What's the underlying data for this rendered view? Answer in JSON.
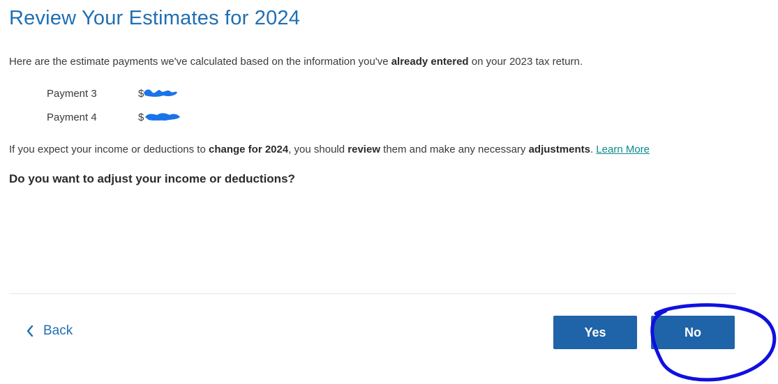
{
  "page_title": "Review Your Estimates for 2024",
  "intro": {
    "part1": "Here are the estimate payments we've calculated based on the information you've ",
    "bold": "already entered",
    "part2": " on your 2023 tax return."
  },
  "payments": [
    {
      "label": "Payment 3",
      "amount_prefix": "$"
    },
    {
      "label": "Payment 4",
      "amount_prefix": "$"
    }
  ],
  "advice": {
    "part1": "If you expect your income or deductions to ",
    "bold1": "change for 2024",
    "part2": ", you should ",
    "bold2": "review",
    "part3": " them and make any necessary ",
    "bold3": "adjustments",
    "part4": ". ",
    "link": "Learn More"
  },
  "question": "Do you want to adjust your income or deductions?",
  "nav": {
    "back_label": "Back",
    "yes_label": "Yes",
    "no_label": "No"
  },
  "colors": {
    "title": "#1f6fb2",
    "button": "#1f63a8",
    "link": "#0d8a8a",
    "annotation": "#1010e0",
    "redaction": "#1a73e8"
  }
}
